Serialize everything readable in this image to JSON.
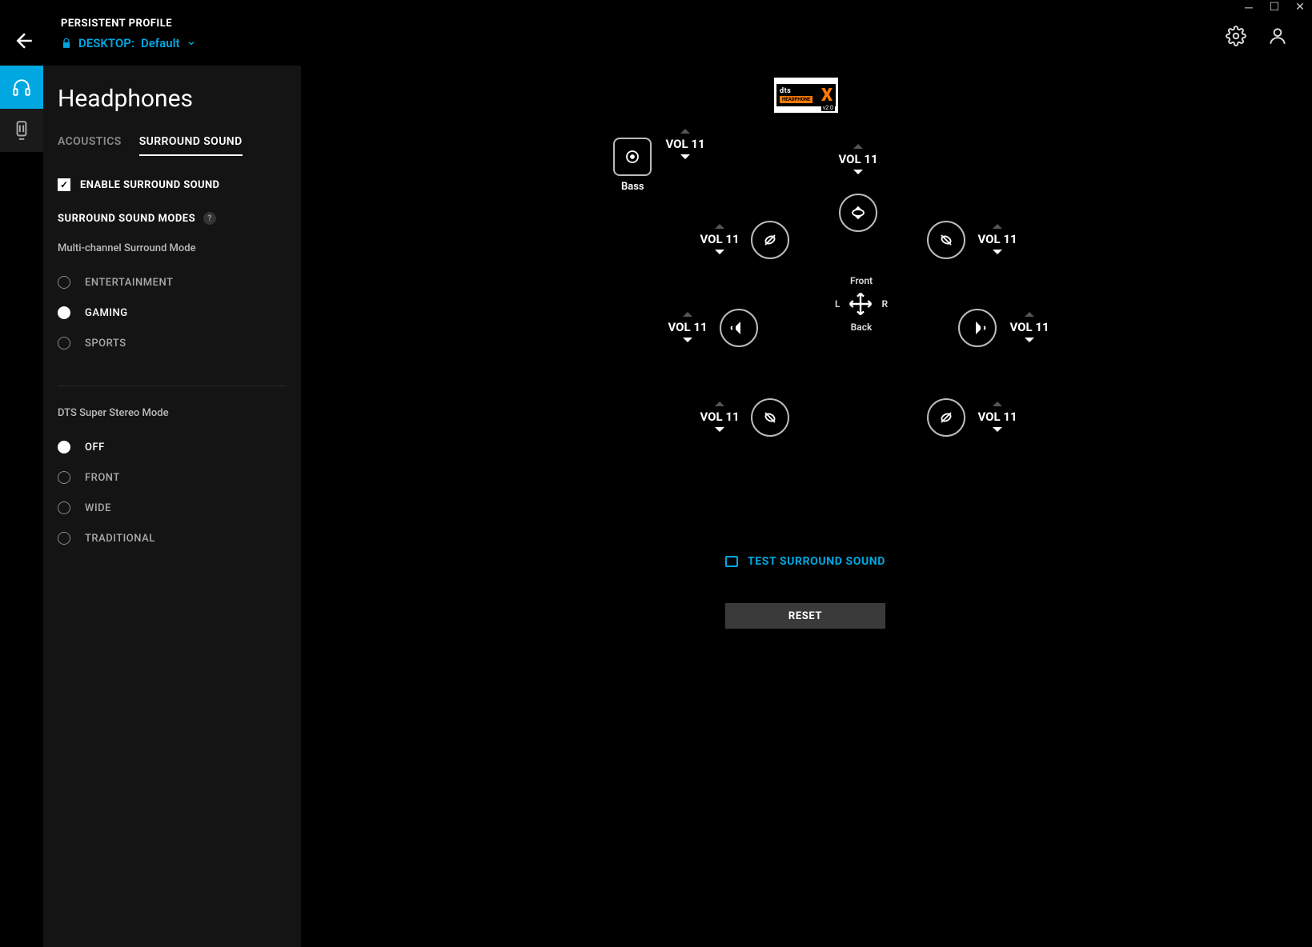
{
  "header": {
    "profile_label": "PERSISTENT PROFILE",
    "profile_prefix": "DESKTOP:",
    "profile_name": "Default"
  },
  "sidebar": {
    "title": "Headphones",
    "tabs": {
      "acoustics": "ACOUSTICS",
      "surround": "SURROUND SOUND"
    },
    "enable_label": "ENABLE SURROUND SOUND",
    "modes_label": "SURROUND SOUND MODES",
    "multi_label": "Multi-channel Surround Mode",
    "multi_options": [
      "ENTERTAINMENT",
      "GAMING",
      "SPORTS"
    ],
    "multi_selected": 1,
    "dts_label": "DTS Super Stereo Mode",
    "dts_options": [
      "OFF",
      "FRONT",
      "WIDE",
      "TRADITIONAL"
    ],
    "dts_selected": 0
  },
  "dts_badge": {
    "brand": "dts",
    "sub": "HEADPHONE",
    "x": "X",
    "ver": "v2.0"
  },
  "map": {
    "vol_prefix": "VOL",
    "channels": {
      "bass": {
        "vol": 11,
        "label": "Bass"
      },
      "center": {
        "vol": 11
      },
      "front_left": {
        "vol": 11
      },
      "front_right": {
        "vol": 11
      },
      "side_left": {
        "vol": 11
      },
      "side_right": {
        "vol": 11
      },
      "rear_left": {
        "vol": 11
      },
      "rear_right": {
        "vol": 11
      }
    },
    "compass": {
      "front": "Front",
      "back": "Back",
      "left": "L",
      "right": "R"
    }
  },
  "actions": {
    "test": "TEST SURROUND SOUND",
    "reset": "RESET"
  }
}
